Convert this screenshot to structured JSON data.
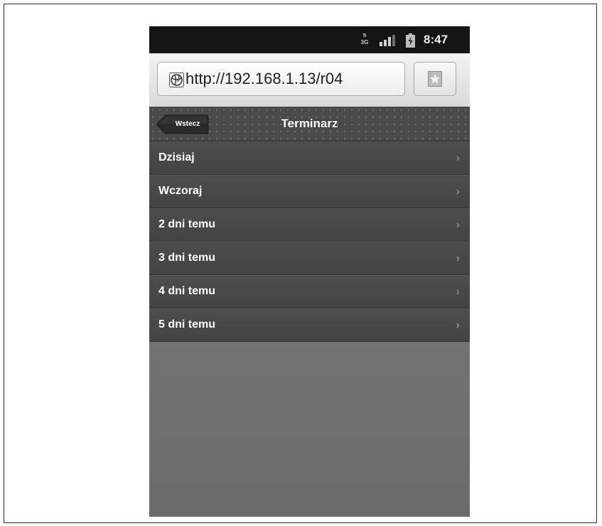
{
  "status_bar": {
    "network_label": "3G",
    "time": "8:47",
    "icons": [
      "network-3g-icon",
      "signal-icon",
      "battery-icon"
    ]
  },
  "browser": {
    "url": "http://192.168.1.13/r04",
    "icons": [
      "globe-icon",
      "bookmark-star-icon"
    ]
  },
  "header": {
    "back_label": "Wstecz",
    "title": "Terminarz"
  },
  "list": {
    "items": [
      {
        "label": "Dzisiaj"
      },
      {
        "label": "Wczoraj"
      },
      {
        "label": "2 dni temu"
      },
      {
        "label": "3 dni temu"
      },
      {
        "label": "4 dni temu"
      },
      {
        "label": "5 dni temu"
      }
    ],
    "chevron": "›"
  },
  "colors": {
    "status_bar": "#141414",
    "header": "#4a4a4a",
    "list_item": "#484848",
    "content_bg": "#6f6f6f"
  }
}
